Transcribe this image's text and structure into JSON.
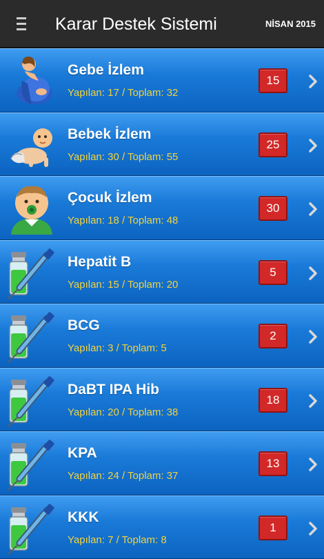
{
  "header": {
    "menu_icon": "hamburger-menu-icon",
    "title": "Karar Destek Sistemi",
    "date": "NİSAN 2015"
  },
  "colors": {
    "app_bar": "#2b2b2b",
    "row_gradient_top": "#3f9cf0",
    "row_gradient_bottom": "#0c63c0",
    "title_text": "#ffffff",
    "subtitle_text": "#f3d33c",
    "badge": "#d32828",
    "chevron": "#d9d9d9"
  },
  "items": [
    {
      "icon": "pregnant-woman-icon",
      "title": "Gebe İzlem",
      "subtitle": "Yapılan: 17 / Toplam: 32",
      "count": "15"
    },
    {
      "icon": "baby-icon",
      "title": "Bebek İzlem",
      "subtitle": "Yapılan: 30 / Toplam: 55",
      "count": "25"
    },
    {
      "icon": "child-icon",
      "title": "Çocuk İzlem",
      "subtitle": "Yapılan: 18 / Toplam: 48",
      "count": "30"
    },
    {
      "icon": "vaccine-syringe-icon",
      "title": "Hepatit B",
      "subtitle": "Yapılan: 15 / Toplam: 20",
      "count": "5"
    },
    {
      "icon": "vaccine-syringe-icon",
      "title": "BCG",
      "subtitle": "Yapılan: 3 / Toplam: 5",
      "count": "2"
    },
    {
      "icon": "vaccine-syringe-icon",
      "title": "DaBT IPA Hib",
      "subtitle": "Yapılan: 20 / Toplam: 38",
      "count": "18"
    },
    {
      "icon": "vaccine-syringe-icon",
      "title": "KPA",
      "subtitle": "Yapılan: 24 / Toplam: 37",
      "count": "13"
    },
    {
      "icon": "vaccine-syringe-icon",
      "title": "KKK",
      "subtitle": "Yapılan: 7 / Toplam: 8",
      "count": "1"
    }
  ]
}
